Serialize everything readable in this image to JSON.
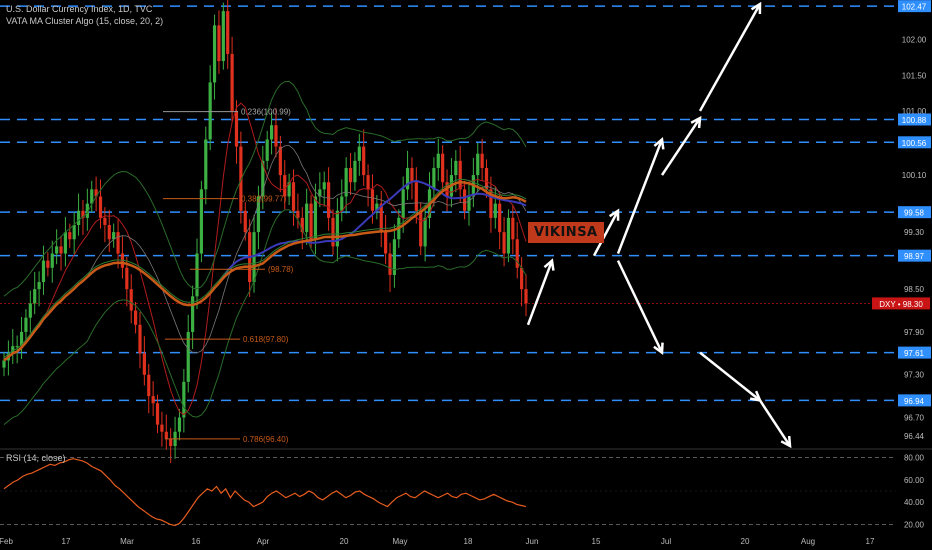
{
  "header": {
    "symbol_line": "U.S. Dollar Currency Index, 1D, TVC",
    "indicator_line": "VATA MA Cluster Algo (15, close, 20, 2)",
    "rsi_label": "RSI (14, close)"
  },
  "annotation_tag": "VIKINSA",
  "current_price": {
    "label": "DXY",
    "value": "98.30"
  },
  "colors": {
    "background": "#000000",
    "up_candle": "#3cb043",
    "down_candle": "#e0301e",
    "level_line": "#2f8fff",
    "ma_blue": "#3a3ab8",
    "ma_orange": "#c85a18",
    "ma_green": "#2e7d32",
    "ma_red": "#b01c1c",
    "band_green": "#2a6b2a",
    "rsi_line": "#e65c1e",
    "tag_bg": "#c0391a",
    "arrow": "#ffffff"
  },
  "chart_data": {
    "type": "candlestick",
    "title": "U.S. Dollar Currency Index, 1D, TVC",
    "x_ticks": [
      "Feb",
      "17",
      "Mar",
      "16",
      "Apr",
      "20",
      "May",
      "18",
      "Jun",
      "15",
      "Jul",
      "20",
      "Aug",
      "17"
    ],
    "y_ticks": [
      "102.47",
      "102.00",
      "101.50",
      "101.00",
      "100.88",
      "100.56",
      "100.10",
      "99.58",
      "99.30",
      "98.97",
      "98.50",
      "98.30",
      "97.90",
      "97.61",
      "97.30",
      "96.94",
      "96.70",
      "96.44"
    ],
    "ylim": [
      96.3,
      102.5
    ],
    "horizontal_levels": [
      102.47,
      100.88,
      100.56,
      99.58,
      98.97,
      97.61,
      96.94
    ],
    "candles_close": [
      97.5,
      97.6,
      97.7,
      97.7,
      97.9,
      98.1,
      98.3,
      98.5,
      98.6,
      98.9,
      98.8,
      99.0,
      99.1,
      99.0,
      99.3,
      99.2,
      99.4,
      99.6,
      99.5,
      99.7,
      99.9,
      99.8,
      99.5,
      99.4,
      99.2,
      99.3,
      99.0,
      98.8,
      98.5,
      98.2,
      98.0,
      97.6,
      97.3,
      97.0,
      96.9,
      96.6,
      96.5,
      96.4,
      96.3,
      96.5,
      96.7,
      97.2,
      97.9,
      98.4,
      99.0,
      99.9,
      100.6,
      101.4,
      102.2,
      101.7,
      102.4,
      101.8,
      101.0,
      100.5,
      99.6,
      99.3,
      98.6,
      99.3,
      99.8,
      100.3,
      100.6,
      100.8,
      100.5,
      100.1,
      99.8,
      100.0,
      99.6,
      99.5,
      99.3,
      99.7,
      99.2,
      99.8,
      99.9,
      100.0,
      99.5,
      99.1,
      99.6,
      99.8,
      100.2,
      100.0,
      100.3,
      100.5,
      100.1,
      99.9,
      99.6,
      99.7,
      99.3,
      99.0,
      98.7,
      99.2,
      99.5,
      99.9,
      100.2,
      100.0,
      99.6,
      99.1,
      99.5,
      99.9,
      100.2,
      100.4,
      100.0,
      99.8,
      100.1,
      100.3,
      99.9,
      99.6,
      99.8,
      100.1,
      100.4,
      100.2,
      99.9,
      99.5,
      99.7,
      99.3,
      99.0,
      99.5,
      99.2,
      98.8,
      98.5,
      98.3
    ],
    "fib_labels": [
      {
        "label": "0.236(100.99)",
        "value": 100.99
      },
      {
        "label": "0.382(99.77)",
        "value": 99.77
      },
      {
        "label": "(98.78)",
        "value": 98.78
      },
      {
        "label": "0.618(97.80)",
        "value": 97.8
      },
      {
        "label": "0.786(96.40)",
        "value": 96.4
      }
    ],
    "rsi": {
      "name": "RSI (14, close)",
      "y_ticks": [
        "80.00",
        "60.00",
        "40.00",
        "20.00"
      ],
      "ylim": [
        15,
        85
      ],
      "values": [
        52,
        55,
        58,
        60,
        63,
        65,
        66,
        68,
        70,
        72,
        74,
        73,
        75,
        76,
        78,
        79,
        78,
        77,
        75,
        72,
        70,
        68,
        64,
        60,
        55,
        52,
        48,
        44,
        40,
        36,
        33,
        30,
        27,
        25,
        24,
        22,
        20,
        19,
        21,
        26,
        32,
        38,
        44,
        48,
        52,
        50,
        54,
        48,
        52,
        44,
        50,
        46,
        42,
        40,
        36,
        38,
        40,
        45,
        48,
        50,
        47,
        44,
        46,
        48,
        45,
        47,
        50,
        48,
        44,
        42,
        45,
        48,
        50,
        47,
        44,
        46,
        49,
        50,
        47,
        45,
        43,
        40,
        38,
        36,
        40,
        44,
        46,
        48,
        45,
        44,
        47,
        50,
        48,
        46,
        44,
        46,
        48,
        45,
        44,
        47,
        48,
        46,
        44,
        42,
        43,
        45,
        47,
        45,
        43,
        41,
        40,
        38,
        37,
        36
      ]
    },
    "projection_arrows": [
      {
        "from": [
          0,
          98.0
        ],
        "to": [
          1,
          98.9
        ]
      },
      {
        "from": [
          2,
          98.97
        ],
        "to": [
          3,
          99.6
        ]
      },
      {
        "from": [
          3,
          99.0
        ],
        "to": [
          4,
          100.6
        ]
      },
      {
        "from": [
          4,
          100.1
        ],
        "to": [
          5,
          100.9
        ]
      },
      {
        "from": [
          5,
          101.0
        ],
        "to": [
          6,
          102.5
        ]
      },
      {
        "from": [
          3,
          98.9
        ],
        "to": [
          4,
          97.61
        ]
      },
      {
        "from": [
          5,
          97.61
        ],
        "to": [
          6,
          96.94
        ]
      },
      {
        "from": [
          6,
          96.94
        ],
        "to": [
          7,
          96.3
        ]
      }
    ]
  }
}
